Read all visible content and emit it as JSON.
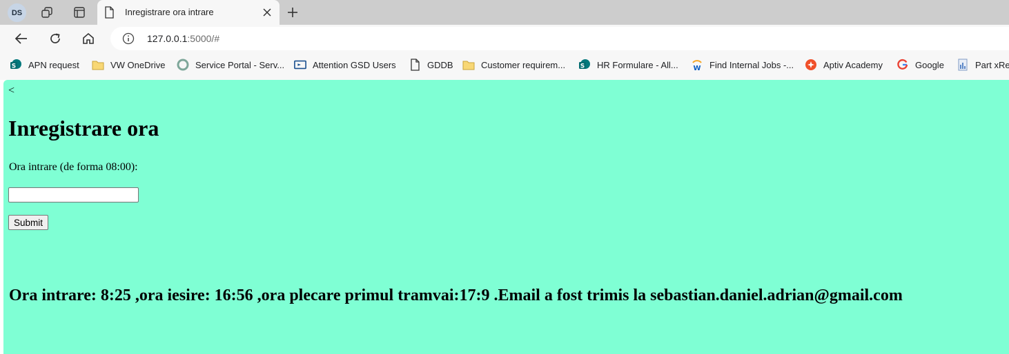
{
  "browser": {
    "profile_initials": "DS",
    "tab": {
      "title": "Inregistrare ora intrare"
    },
    "address": {
      "host": "127.0.0.1",
      "path": ":5000/#"
    },
    "bookmarks": [
      {
        "label": "APN request"
      },
      {
        "label": "VW OneDrive"
      },
      {
        "label": "Service Portal - Serv..."
      },
      {
        "label": "Attention GSD Users"
      },
      {
        "label": "GDDB"
      },
      {
        "label": "Customer requirem..."
      },
      {
        "label": "HR Formulare - All..."
      },
      {
        "label": "Find Internal Jobs -..."
      },
      {
        "label": "Aptiv Academy"
      },
      {
        "label": "Google"
      },
      {
        "label": "Part xRef"
      }
    ],
    "colors": {
      "tabstrip": "#cdcdcd",
      "toolbar": "#f7f7f7"
    }
  },
  "page": {
    "back_link": "<",
    "title": "Inregistrare ora",
    "form": {
      "label": "Ora intrare (de forma 08:00):",
      "input_value": "",
      "submit_label": "Submit"
    },
    "result": "Ora intrare: 8:25 ,ora iesire: 16:56 ,ora plecare primul tramvai:17:9 .Email a fost trimis la sebastian.daniel.adrian@gmail.com",
    "background_color": "#7fffd4"
  }
}
